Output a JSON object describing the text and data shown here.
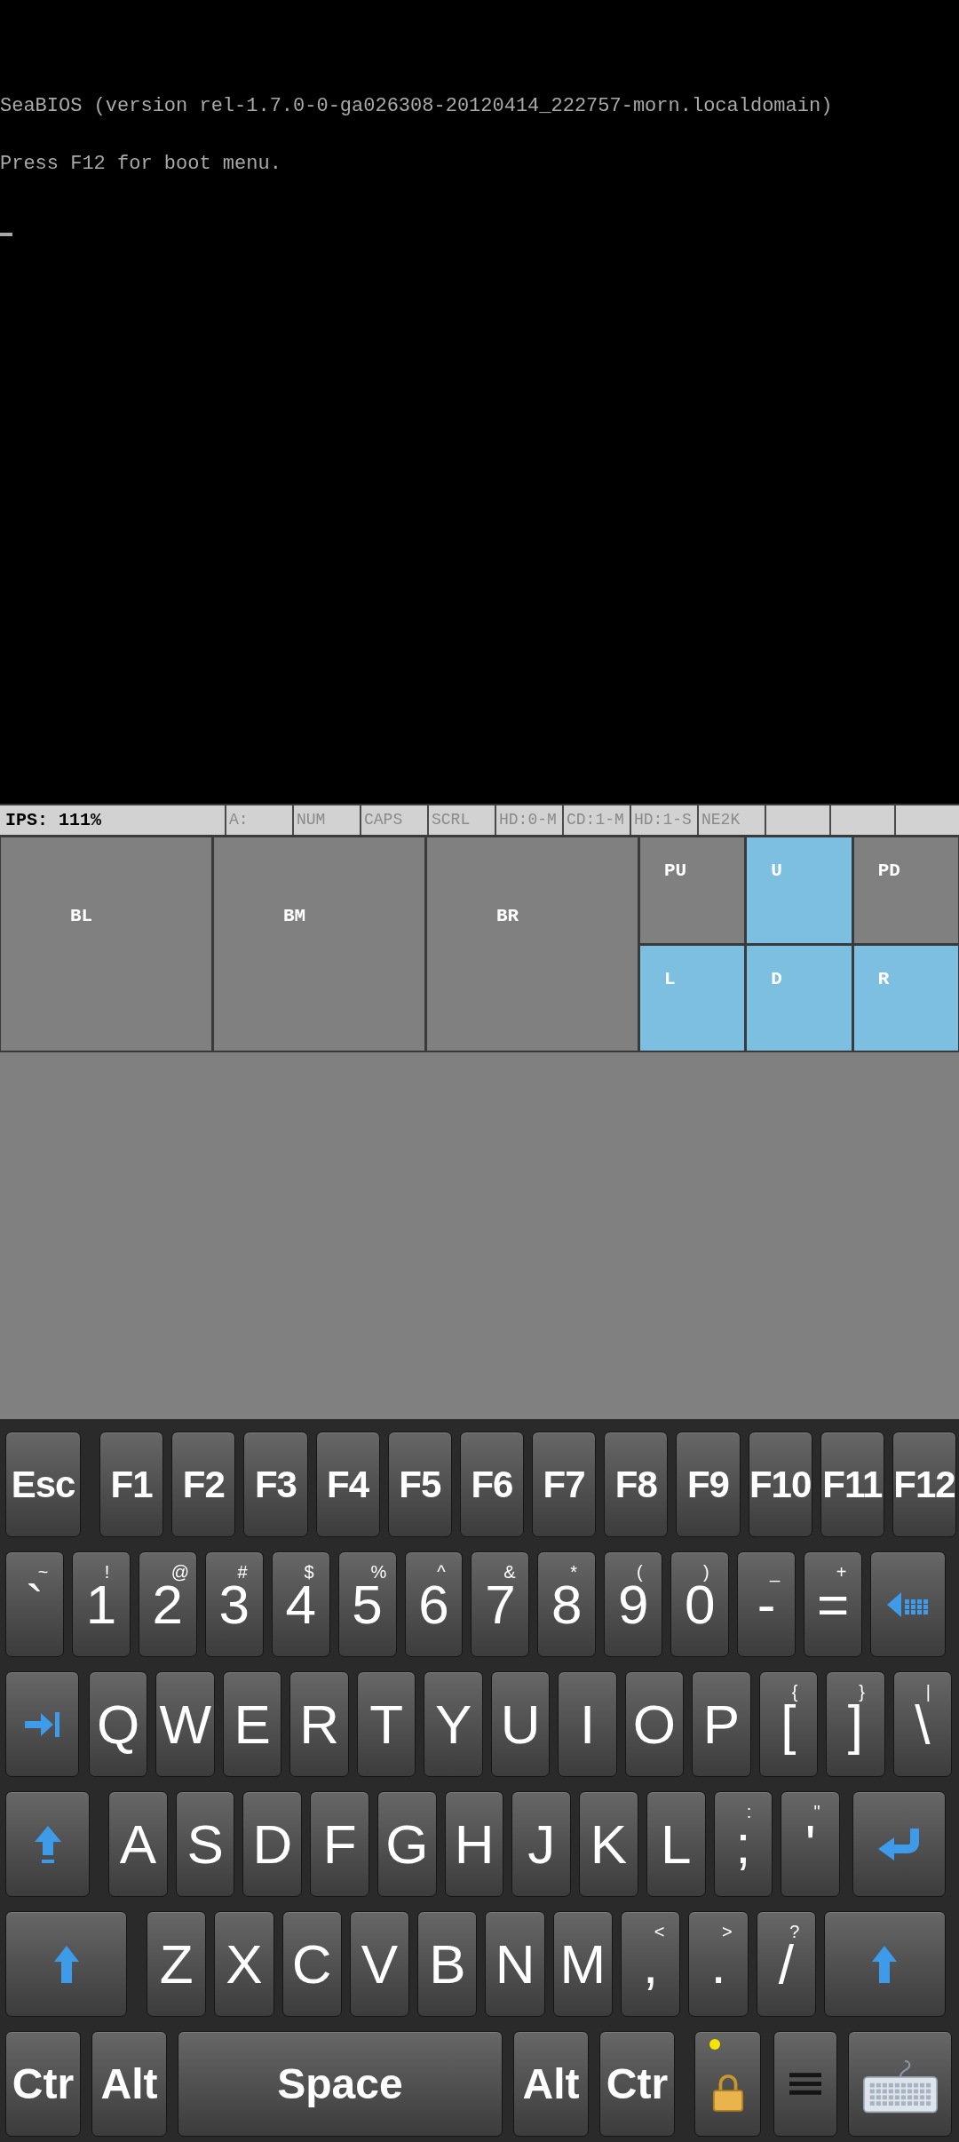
{
  "console": {
    "lines": [
      "SeaBIOS (version rel-1.7.0-0-ga026308-20120414_222757-morn.localdomain)",
      "Press F12 for boot menu."
    ]
  },
  "status_bar": {
    "ips": "IPS: 111%",
    "indicators": [
      {
        "label": "A:",
        "active": false
      },
      {
        "label": "NUM",
        "active": false
      },
      {
        "label": "CAPS",
        "active": false
      },
      {
        "label": "SCRL",
        "active": false
      },
      {
        "label": "HD:0-M",
        "active": false
      },
      {
        "label": "CD:1-M",
        "active": false
      },
      {
        "label": "HD:1-S",
        "active": false
      },
      {
        "label": "NE2K",
        "active": false
      }
    ]
  },
  "touch_pad": {
    "large_buttons": [
      {
        "label": "BL"
      },
      {
        "label": "BM"
      },
      {
        "label": "BR"
      }
    ],
    "direction_buttons": [
      {
        "label": "PU",
        "color": "#808080"
      },
      {
        "label": "U",
        "color": "#7dbfe0"
      },
      {
        "label": "PD",
        "color": "#808080"
      },
      {
        "label": "L",
        "color": "#7dbfe0"
      },
      {
        "label": "D",
        "color": "#7dbfe0"
      },
      {
        "label": "R",
        "color": "#7dbfe0"
      }
    ]
  },
  "keyboard": {
    "rows": [
      {
        "keys": [
          {
            "kind": "mod",
            "label": "Esc"
          },
          {
            "kind": "fkey",
            "label": "F1"
          },
          {
            "kind": "fkey",
            "label": "F2"
          },
          {
            "kind": "fkey",
            "label": "F3"
          },
          {
            "kind": "fkey",
            "label": "F4"
          },
          {
            "kind": "fkey",
            "label": "F5"
          },
          {
            "kind": "fkey",
            "label": "F6"
          },
          {
            "kind": "fkey",
            "label": "F7"
          },
          {
            "kind": "fkey",
            "label": "F8"
          },
          {
            "kind": "fkey",
            "label": "F9"
          },
          {
            "kind": "fkey",
            "label": "F10"
          },
          {
            "kind": "fkey",
            "label": "F11"
          },
          {
            "kind": "fkey",
            "label": "F12"
          }
        ]
      },
      {
        "keys": [
          {
            "kind": "char",
            "label": "`",
            "shift": "~"
          },
          {
            "kind": "char",
            "label": "1",
            "shift": "!"
          },
          {
            "kind": "char",
            "label": "2",
            "shift": "@"
          },
          {
            "kind": "char",
            "label": "3",
            "shift": "#"
          },
          {
            "kind": "char",
            "label": "4",
            "shift": "$"
          },
          {
            "kind": "char",
            "label": "5",
            "shift": "%"
          },
          {
            "kind": "char",
            "label": "6",
            "shift": "^"
          },
          {
            "kind": "char",
            "label": "7",
            "shift": "&"
          },
          {
            "kind": "char",
            "label": "8",
            "shift": "*"
          },
          {
            "kind": "char",
            "label": "9",
            "shift": "("
          },
          {
            "kind": "char",
            "label": "0",
            "shift": ")"
          },
          {
            "kind": "char",
            "label": "-",
            "shift": "_"
          },
          {
            "kind": "char",
            "label": "=",
            "shift": "+"
          },
          {
            "kind": "backspace"
          }
        ]
      },
      {
        "keys": [
          {
            "kind": "tab"
          },
          {
            "kind": "char",
            "label": "Q"
          },
          {
            "kind": "char",
            "label": "W"
          },
          {
            "kind": "char",
            "label": "E"
          },
          {
            "kind": "char",
            "label": "R"
          },
          {
            "kind": "char",
            "label": "T"
          },
          {
            "kind": "char",
            "label": "Y"
          },
          {
            "kind": "char",
            "label": "U"
          },
          {
            "kind": "char",
            "label": "I"
          },
          {
            "kind": "char",
            "label": "O"
          },
          {
            "kind": "char",
            "label": "P"
          },
          {
            "kind": "char",
            "label": "[",
            "shift": "{"
          },
          {
            "kind": "char",
            "label": "]",
            "shift": "}"
          },
          {
            "kind": "char",
            "label": "\\",
            "shift": "|"
          }
        ]
      },
      {
        "keys": [
          {
            "kind": "caps"
          },
          {
            "kind": "char",
            "label": "A"
          },
          {
            "kind": "char",
            "label": "S"
          },
          {
            "kind": "char",
            "label": "D"
          },
          {
            "kind": "char",
            "label": "F"
          },
          {
            "kind": "char",
            "label": "G"
          },
          {
            "kind": "char",
            "label": "H"
          },
          {
            "kind": "char",
            "label": "J"
          },
          {
            "kind": "char",
            "label": "K"
          },
          {
            "kind": "char",
            "label": "L"
          },
          {
            "kind": "char",
            "label": ";",
            "shift": ":"
          },
          {
            "kind": "char",
            "label": "'",
            "shift": "\""
          },
          {
            "kind": "enter"
          }
        ]
      },
      {
        "keys": [
          {
            "kind": "shift"
          },
          {
            "kind": "char",
            "label": "Z"
          },
          {
            "kind": "char",
            "label": "X"
          },
          {
            "kind": "char",
            "label": "C"
          },
          {
            "kind": "char",
            "label": "V"
          },
          {
            "kind": "char",
            "label": "B"
          },
          {
            "kind": "char",
            "label": "N"
          },
          {
            "kind": "char",
            "label": "M"
          },
          {
            "kind": "char",
            "label": ",",
            "shift": "<"
          },
          {
            "kind": "char",
            "label": ".",
            "shift": ">"
          },
          {
            "kind": "char",
            "label": "/",
            "shift": "?"
          },
          {
            "kind": "shift"
          }
        ]
      },
      {
        "keys": [
          {
            "kind": "mod",
            "label": "Ctr"
          },
          {
            "kind": "mod",
            "label": "Alt"
          },
          {
            "kind": "space",
            "label": "Space"
          },
          {
            "kind": "mod",
            "label": "Alt"
          },
          {
            "kind": "mod",
            "label": "Ctr"
          },
          {
            "kind": "lock"
          },
          {
            "kind": "menu"
          },
          {
            "kind": "keyboard"
          }
        ]
      }
    ]
  }
}
